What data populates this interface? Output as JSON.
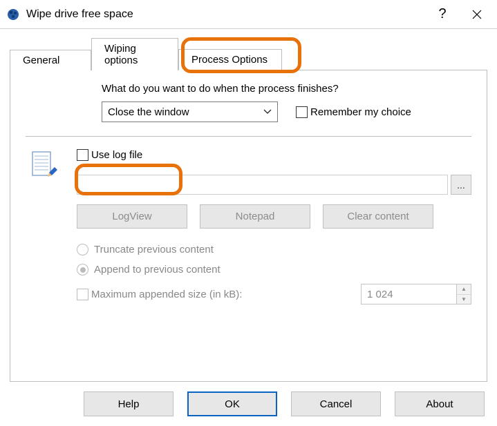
{
  "titlebar": {
    "title": "Wipe drive free space",
    "help_icon": "?",
    "close_icon": "✕"
  },
  "tabs": {
    "general": "General",
    "wiping": "Wiping options",
    "process": "Process Options"
  },
  "process": {
    "question": "What do you want to do when the process finishes?",
    "finish_action_selected": "Close the window",
    "remember_label": "Remember my choice"
  },
  "log": {
    "use_log_label": "Use log file",
    "path_value": "",
    "browse_label": "...",
    "logview_btn": "LogView",
    "notepad_btn": "Notepad",
    "clear_btn": "Clear content",
    "truncate_label": "Truncate previous content",
    "append_label": "Append to previous content",
    "max_append_label": "Maximum appended size (in kB):",
    "max_append_value": "1 024"
  },
  "footer": {
    "help": "Help",
    "ok": "OK",
    "cancel": "Cancel",
    "about": "About"
  }
}
